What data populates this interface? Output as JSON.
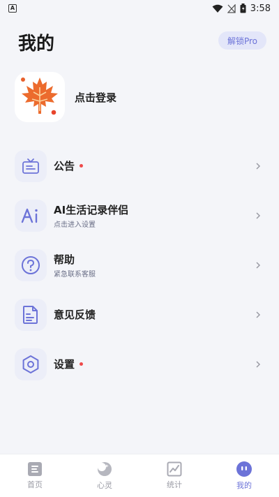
{
  "status_bar": {
    "time": "3:58",
    "app_badge": "A"
  },
  "header": {
    "title": "我的",
    "unlock_label": "解锁Pro"
  },
  "profile": {
    "login_label": "点击登录"
  },
  "menu": [
    {
      "title": "公告",
      "subtitle": "",
      "dot": true,
      "icon": "announcement-icon"
    },
    {
      "title": "AI生活记录伴侣",
      "subtitle": "点击进入设置",
      "dot": false,
      "icon": "ai-icon"
    },
    {
      "title": "帮助",
      "subtitle": "紧急联系客服",
      "dot": false,
      "icon": "help-icon"
    },
    {
      "title": "意见反馈",
      "subtitle": "",
      "dot": false,
      "icon": "feedback-icon"
    },
    {
      "title": "设置",
      "subtitle": "",
      "dot": true,
      "icon": "settings-icon"
    }
  ],
  "tabs": [
    {
      "label": "首页",
      "icon": "home-icon",
      "active": false
    },
    {
      "label": "心灵",
      "icon": "moon-icon",
      "active": false
    },
    {
      "label": "统计",
      "icon": "chart-icon",
      "active": false
    },
    {
      "label": "我的",
      "icon": "profile-icon",
      "active": true
    }
  ],
  "colors": {
    "accent": "#6c73d8",
    "background": "#f4f5f9",
    "dot": "#ee4a4a",
    "maple": "#e8602c"
  }
}
